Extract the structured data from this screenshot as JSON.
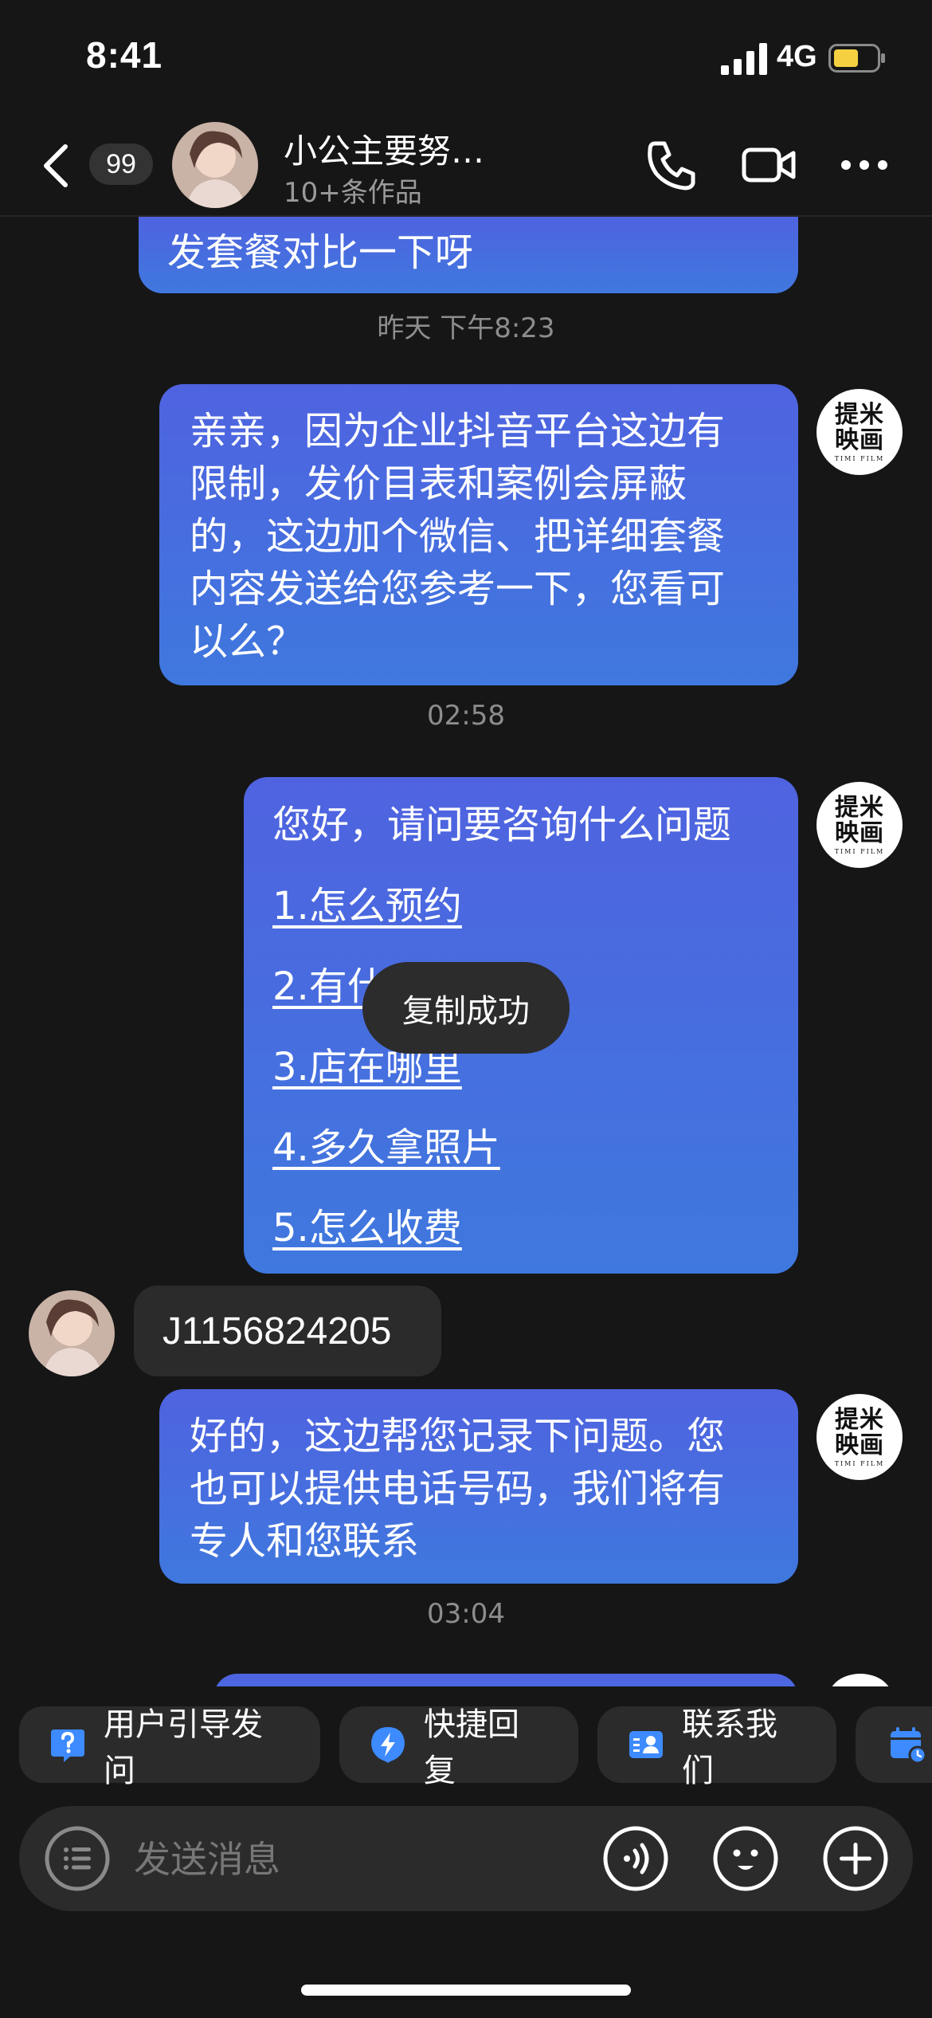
{
  "status_bar": {
    "time": "8:41",
    "network": "4G"
  },
  "header": {
    "unread_count": "99",
    "contact_name": "小公主要努…",
    "contact_subtitle": "10+条作品"
  },
  "brand_avatar": {
    "main_text_line1": "提米",
    "main_text_line2": "映画",
    "sub_text": "TIMI FILM"
  },
  "messages": {
    "partial_top": "发套餐对比一下呀",
    "ts1": "昨天 下午8:23",
    "m1": [
      "亲亲，因为企业抖音平台这边有",
      "限制，发价目表和案例会屏蔽",
      "的，这边加个微信、把详细套餐",
      "内容发送给您参考一下，您看可",
      "以么？"
    ],
    "ts2": "02:58",
    "m2_title": "您好，请问要咨询什么问题",
    "m2_options": [
      "1.怎么预约",
      "2.有什",
      "3.店在哪里",
      "4.多久拿照片",
      "5.怎么收费"
    ],
    "toast": "复制成功",
    "received": "J1156824205",
    "m3": [
      "好的，这边帮您记录下问题。您",
      "也可以提供电话号码，我们将有",
      "专人和您联系"
    ],
    "ts3": "03:04"
  },
  "quick_actions": [
    {
      "label": "用户引导发问",
      "icon": "question-icon"
    },
    {
      "label": "快捷回复",
      "icon": "lightning-icon"
    },
    {
      "label": "联系我们",
      "icon": "contact-card-icon"
    },
    {
      "label": "",
      "icon": "calendar-icon"
    }
  ],
  "input": {
    "placeholder": "发送消息"
  },
  "colors": {
    "background": "#161616",
    "bubble_top": "#4f63e0",
    "bubble_bottom": "#3f78de",
    "chip_bg": "#2b2b2b",
    "battery": "#f5d142"
  }
}
